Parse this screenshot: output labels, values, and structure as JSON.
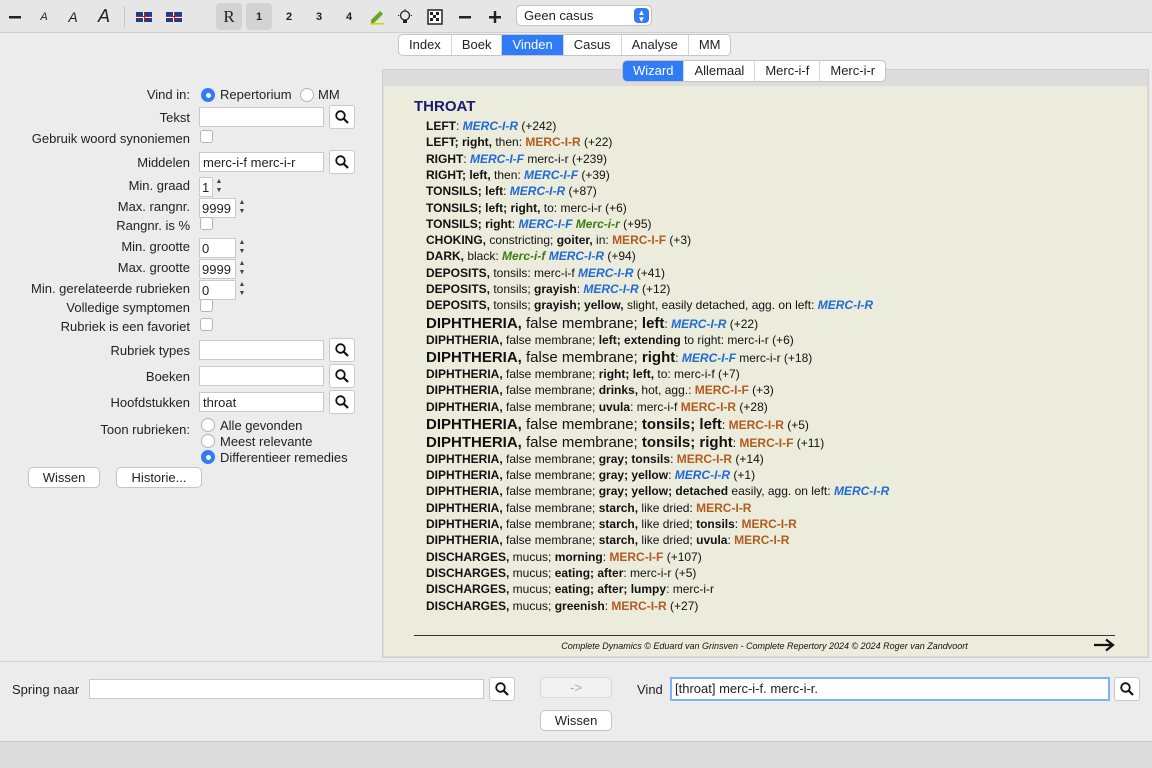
{
  "toolbar": {
    "font_small": "A",
    "font_medium": "A",
    "font_large": "A",
    "mode_r": "R",
    "level1": "1",
    "level2": "2",
    "level3": "3",
    "level4": "4",
    "case_select": "Geen casus"
  },
  "main_tabs": [
    "Index",
    "Boek",
    "Vinden",
    "Casus",
    "Analyse",
    "MM"
  ],
  "main_tabs_active": "Vinden",
  "sub_tabs": [
    "Wizard",
    "Allemaal",
    "Merc-i-f",
    "Merc-i-r"
  ],
  "sub_tabs_active": "Wizard",
  "form": {
    "vind_in_label": "Vind in:",
    "vind_in_opt1": "Repertorium",
    "vind_in_opt2": "MM",
    "tekst_label": "Tekst",
    "tekst_value": "",
    "synoniemen_label": "Gebruik woord synoniemen",
    "middelen_label": "Middelen",
    "middelen_value": "merc-i-f merc-i-r",
    "min_graad_label": "Min. graad",
    "min_graad_value": "1",
    "max_rangnr_label": "Max. rangnr.",
    "max_rangnr_value": "9999",
    "rangnr_pct_label": "Rangnr. is %",
    "min_grootte_label": "Min. grootte",
    "min_grootte_value": "0",
    "max_grootte_label": "Max. grootte",
    "max_grootte_value": "9999",
    "min_gerel_label": "Min. gerelateerde rubrieken",
    "min_gerel_value": "0",
    "volledige_label": "Volledige symptomen",
    "favoriet_label": "Rubriek is een favoriet",
    "rubriek_types_label": "Rubriek types",
    "rubriek_types_value": "",
    "boeken_label": "Boeken",
    "boeken_value": "",
    "hoofdstukken_label": "Hoofdstukken",
    "hoofdstukken_value": "throat",
    "toon_label": "Toon rubrieken:",
    "toon_opt1": "Alle gevonden",
    "toon_opt2": "Meest relevante",
    "toon_opt3": "Differentieer remedies",
    "wissen_label": "Wissen",
    "historie_label": "Historie..."
  },
  "results": {
    "chapter": "THROAT",
    "rows": [
      [
        [
          "b",
          "LEFT"
        ],
        [
          "n",
          ": "
        ],
        [
          "bl",
          "MERC-I-R"
        ],
        [
          "n",
          " (+242)"
        ]
      ],
      [
        [
          "b",
          "LEFT; right,"
        ],
        [
          "n",
          " then: "
        ],
        [
          "g",
          "MERC-I-R"
        ],
        [
          "n",
          " (+22)"
        ]
      ],
      [
        [
          "b",
          "RIGHT"
        ],
        [
          "n",
          ": "
        ],
        [
          "bl",
          "MERC-I-F"
        ],
        [
          "n",
          " merc-i-r (+239)"
        ]
      ],
      [
        [
          "b",
          "RIGHT; left,"
        ],
        [
          "n",
          " then: "
        ],
        [
          "bl",
          "MERC-I-F"
        ],
        [
          "n",
          " (+39)"
        ]
      ],
      [
        [
          "b",
          "TONSILS; left"
        ],
        [
          "n",
          ": "
        ],
        [
          "bl",
          "MERC-I-R"
        ],
        [
          "n",
          " (+87)"
        ]
      ],
      [
        [
          "b",
          "TONSILS; left; right,"
        ],
        [
          "n",
          " to: merc-i-r (+6)"
        ]
      ],
      [
        [
          "b",
          "TONSILS; right"
        ],
        [
          "n",
          ": "
        ],
        [
          "bl",
          "MERC-I-F"
        ],
        [
          "n",
          " "
        ],
        [
          "gr",
          "Merc-i-r"
        ],
        [
          "n",
          " (+95)"
        ]
      ],
      [
        [
          "b",
          "CHOKING,"
        ],
        [
          "n",
          " constricting; "
        ],
        [
          "b",
          "goiter,"
        ],
        [
          "n",
          " in: "
        ],
        [
          "g",
          "MERC-I-F"
        ],
        [
          "n",
          " (+3)"
        ]
      ],
      [
        [
          "b",
          "DARK,"
        ],
        [
          "n",
          " black: "
        ],
        [
          "gr",
          "Merc-i-f"
        ],
        [
          "n",
          " "
        ],
        [
          "bl",
          "MERC-I-R"
        ],
        [
          "n",
          " (+94)"
        ]
      ],
      [
        [
          "b",
          "DEPOSITS,"
        ],
        [
          "n",
          " tonsils: merc-i-f "
        ],
        [
          "bl",
          "MERC-I-R"
        ],
        [
          "n",
          " (+41)"
        ]
      ],
      [
        [
          "b",
          "DEPOSITS,"
        ],
        [
          "n",
          " tonsils; "
        ],
        [
          "b",
          "grayish"
        ],
        [
          "n",
          ": "
        ],
        [
          "bl",
          "MERC-I-R"
        ],
        [
          "n",
          " (+12)"
        ]
      ],
      [
        [
          "b",
          "DEPOSITS,"
        ],
        [
          "n",
          " tonsils; "
        ],
        [
          "b",
          "grayish; yellow,"
        ],
        [
          "n",
          " slight, easily detached, agg. on left: "
        ],
        [
          "bl",
          "MERC-I-R"
        ]
      ],
      [
        [
          "bb",
          "DIPHTHERIA,"
        ],
        [
          "nb",
          " false membrane; "
        ],
        [
          "bb",
          "left"
        ],
        [
          "n",
          ": "
        ],
        [
          "bl",
          "MERC-I-R"
        ],
        [
          "n",
          " (+22)"
        ]
      ],
      [
        [
          "b",
          "DIPHTHERIA,"
        ],
        [
          "n",
          " false membrane; "
        ],
        [
          "b",
          "left; extending"
        ],
        [
          "n",
          " to right: merc-i-r (+6)"
        ]
      ],
      [
        [
          "bb",
          "DIPHTHERIA,"
        ],
        [
          "nb",
          " false membrane; "
        ],
        [
          "bb",
          "right"
        ],
        [
          "n",
          ": "
        ],
        [
          "bl",
          "MERC-I-F"
        ],
        [
          "n",
          " merc-i-r (+18)"
        ]
      ],
      [
        [
          "b",
          "DIPHTHERIA,"
        ],
        [
          "n",
          " false membrane; "
        ],
        [
          "b",
          "right; left,"
        ],
        [
          "n",
          " to: merc-i-f (+7)"
        ]
      ],
      [
        [
          "b",
          "DIPHTHERIA,"
        ],
        [
          "n",
          " false membrane; "
        ],
        [
          "b",
          "drinks,"
        ],
        [
          "n",
          " hot, agg.: "
        ],
        [
          "g",
          "MERC-I-F"
        ],
        [
          "n",
          " (+3)"
        ]
      ],
      [
        [
          "b",
          "DIPHTHERIA,"
        ],
        [
          "n",
          " false membrane; "
        ],
        [
          "b",
          "uvula"
        ],
        [
          "n",
          ": merc-i-f "
        ],
        [
          "g",
          "MERC-I-R"
        ],
        [
          "n",
          " (+28)"
        ]
      ],
      [
        [
          "bb",
          "DIPHTHERIA,"
        ],
        [
          "nb",
          " false membrane; "
        ],
        [
          "bb",
          "tonsils; left"
        ],
        [
          "n",
          ": "
        ],
        [
          "g",
          "MERC-I-R"
        ],
        [
          "n",
          " (+5)"
        ]
      ],
      [
        [
          "bb",
          "DIPHTHERIA,"
        ],
        [
          "nb",
          " false membrane; "
        ],
        [
          "bb",
          "tonsils; right"
        ],
        [
          "n",
          ": "
        ],
        [
          "g",
          "MERC-I-F"
        ],
        [
          "n",
          " (+11)"
        ]
      ],
      [
        [
          "b",
          "DIPHTHERIA,"
        ],
        [
          "n",
          " false membrane; "
        ],
        [
          "b",
          "gray; tonsils"
        ],
        [
          "n",
          ": "
        ],
        [
          "g",
          "MERC-I-R"
        ],
        [
          "n",
          " (+14)"
        ]
      ],
      [
        [
          "b",
          "DIPHTHERIA,"
        ],
        [
          "n",
          " false membrane; "
        ],
        [
          "b",
          "gray; yellow"
        ],
        [
          "n",
          ": "
        ],
        [
          "bl",
          "MERC-I-R"
        ],
        [
          "n",
          " (+1)"
        ]
      ],
      [
        [
          "b",
          "DIPHTHERIA,"
        ],
        [
          "n",
          " false membrane; "
        ],
        [
          "b",
          "gray; yellow; detached"
        ],
        [
          "n",
          " easily, agg. on left: "
        ],
        [
          "bl",
          "MERC-I-R"
        ]
      ],
      [
        [
          "b",
          "DIPHTHERIA,"
        ],
        [
          "n",
          " false membrane; "
        ],
        [
          "b",
          "starch,"
        ],
        [
          "n",
          " like dried: "
        ],
        [
          "g",
          "MERC-I-R"
        ]
      ],
      [
        [
          "b",
          "DIPHTHERIA,"
        ],
        [
          "n",
          " false membrane; "
        ],
        [
          "b",
          "starch,"
        ],
        [
          "n",
          " like dried; "
        ],
        [
          "b",
          "tonsils"
        ],
        [
          "n",
          ": "
        ],
        [
          "g",
          "MERC-I-R"
        ]
      ],
      [
        [
          "b",
          "DIPHTHERIA,"
        ],
        [
          "n",
          " false membrane; "
        ],
        [
          "b",
          "starch,"
        ],
        [
          "n",
          " like dried; "
        ],
        [
          "b",
          "uvula"
        ],
        [
          "n",
          ": "
        ],
        [
          "g",
          "MERC-I-R"
        ]
      ],
      [
        [
          "b",
          "DISCHARGES,"
        ],
        [
          "n",
          " mucus; "
        ],
        [
          "b",
          "morning"
        ],
        [
          "n",
          ": "
        ],
        [
          "g",
          "MERC-I-F"
        ],
        [
          "n",
          " (+107)"
        ]
      ],
      [
        [
          "b",
          "DISCHARGES,"
        ],
        [
          "n",
          " mucus; "
        ],
        [
          "b",
          "eating; after"
        ],
        [
          "n",
          ": merc-i-r (+5)"
        ]
      ],
      [
        [
          "b",
          "DISCHARGES,"
        ],
        [
          "n",
          " mucus; "
        ],
        [
          "b",
          "eating; after; lumpy"
        ],
        [
          "n",
          ": merc-i-r"
        ]
      ],
      [
        [
          "b",
          "DISCHARGES,"
        ],
        [
          "n",
          " mucus; "
        ],
        [
          "b",
          "greenish"
        ],
        [
          "n",
          ": "
        ],
        [
          "g",
          "MERC-I-R"
        ],
        [
          "n",
          " (+27)"
        ]
      ]
    ],
    "footer": "Complete Dynamics © Eduard van Grinsven   -   Complete Repertory 2024 © 2024 Roger van Zandvoort"
  },
  "bottom": {
    "spring_label": "Spring naar",
    "spring_value": "",
    "arrow_button": "->",
    "vind_label": "Vind",
    "vind_value": "[throat] merc-i-f. merc-i-r.",
    "wissen_label": "Wissen"
  },
  "colors": {
    "accent": "#2f7cf6",
    "grade_brown": "#b15c1e",
    "grade_blue": "#1f6bd6",
    "grade_green": "#3f7a13",
    "doc_bg": "#ececdc"
  }
}
